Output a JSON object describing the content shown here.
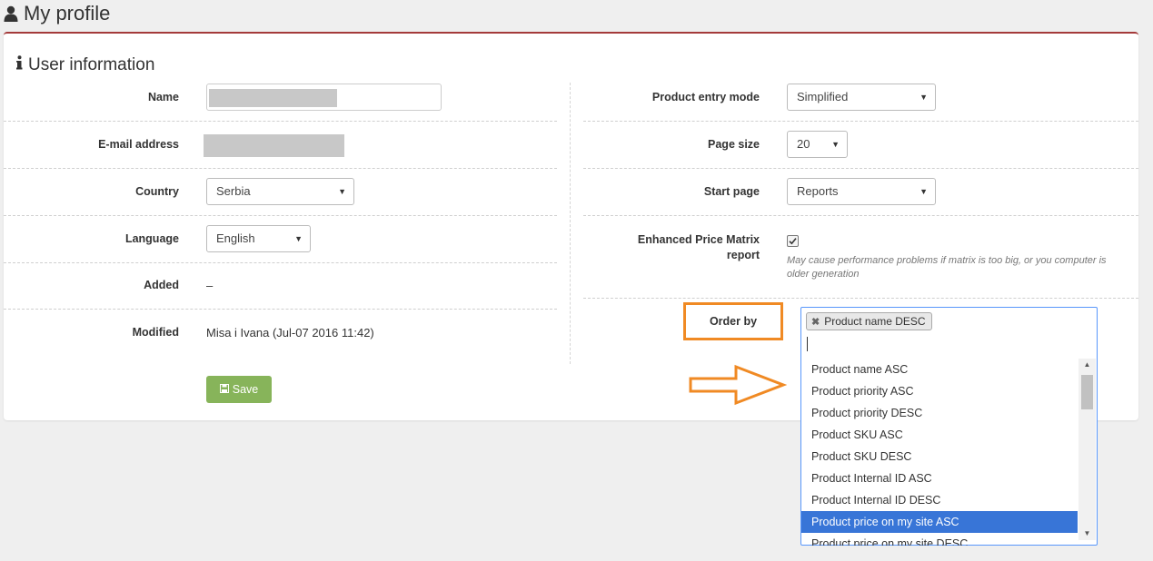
{
  "page": {
    "title": "My profile",
    "title_icon": "user-icon"
  },
  "panel": {
    "heading": "User information",
    "heading_icon": "info-icon"
  },
  "left": {
    "name_label": "Name",
    "email_label": "E-mail address",
    "country_label": "Country",
    "country_value": "Serbia",
    "language_label": "Language",
    "language_value": "English",
    "added_label": "Added",
    "added_value": "–",
    "modified_label": "Modified",
    "modified_value": "Misa i Ivana (Jul-07 2016 11:42)",
    "save_label": "Save",
    "save_icon": "floppy-disk-icon"
  },
  "right": {
    "product_entry_label": "Product entry mode",
    "product_entry_value": "Simplified",
    "page_size_label": "Page size",
    "page_size_value": "20",
    "start_page_label": "Start page",
    "start_page_value": "Reports",
    "enhanced_label_line1": "Enhanced Price Matrix",
    "enhanced_label_line2": "report",
    "enhanced_checked": true,
    "enhanced_hint_line1": "May cause performance problems if matrix is too big, or you computer is",
    "enhanced_hint_line2": "older generation",
    "order_by_label": "Order by",
    "order_by_selected_tag": "Product name DESC",
    "order_by_options": [
      "Product name ASC",
      "Product priority ASC",
      "Product priority DESC",
      "Product SKU ASC",
      "Product SKU DESC",
      "Product Internal ID ASC",
      "Product Internal ID DESC",
      "Product price on my site ASC",
      "Product price on my site DESC"
    ],
    "order_by_highlighted_option": "Product price on my site ASC"
  },
  "colors": {
    "annotation_orange": "#f08a24",
    "panel_accent": "#a43a3a",
    "save_green": "#87b45a",
    "highlight_blue": "#3875d7"
  }
}
